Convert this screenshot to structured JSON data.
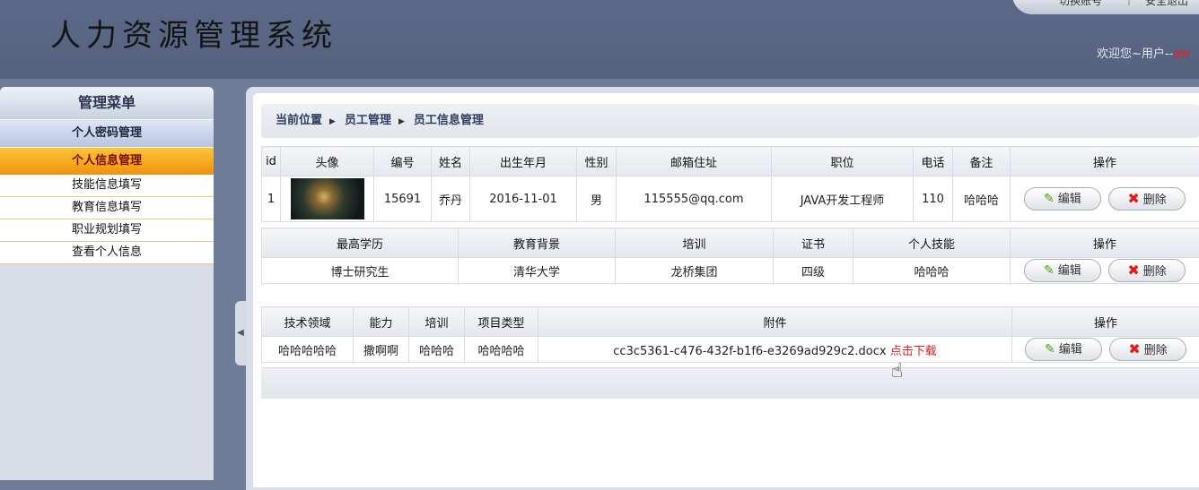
{
  "app": {
    "title": "人力资源管理系统"
  },
  "top_links": [
    "切换账号",
    "安全退出"
  ],
  "welcome": {
    "text": "欢迎您~用户--",
    "user": "qw"
  },
  "sidebar": {
    "title": "管理菜单",
    "groups": [
      {
        "label": "个人密码管理",
        "active": false
      },
      {
        "label": "个人信息管理",
        "active": true
      }
    ],
    "items": [
      "技能信息填写",
      "教育信息填写",
      "职业规划填写",
      "查看个人信息"
    ]
  },
  "breadcrumb": [
    "当前位置",
    "员工管理",
    "员工信息管理"
  ],
  "employee_table": {
    "headers": [
      "id",
      "头像",
      "编号",
      "姓名",
      "出生年月",
      "性别",
      "邮箱住址",
      "职位",
      "电话",
      "备注",
      "操作"
    ],
    "rows": [
      {
        "id": "1",
        "avatar": "avatar-image",
        "number": "15691",
        "name": "乔丹",
        "birth": "2016-11-01",
        "gender": "男",
        "email": "115555@qq.com",
        "position": "JAVA开发工程师",
        "phone": "110",
        "note": "哈哈哈"
      }
    ]
  },
  "education_table": {
    "headers": [
      "最高学历",
      "教育背景",
      "培训",
      "证书",
      "个人技能",
      "操作"
    ],
    "rows": [
      {
        "degree": "博士研究生",
        "background": "清华大学",
        "training": "龙桥集团",
        "certificate": "四级",
        "skills": "哈哈哈"
      }
    ]
  },
  "skill_table": {
    "headers": [
      "技术领域",
      "能力",
      "培训",
      "项目类型",
      "附件",
      "操作"
    ],
    "rows": [
      {
        "field": "哈哈哈哈哈",
        "ability": "撒啊啊",
        "training": "哈哈哈",
        "project_type": "哈哈哈哈",
        "attachment": "cc3c5361-c476-432f-b1f6-e3269ad929c2.docx",
        "download": "点击下载"
      }
    ]
  },
  "actions": {
    "edit": "编辑",
    "delete": "删除"
  },
  "colors": {
    "header_bg": "#5b6888",
    "active_menu": "#f0920e",
    "accent_red": "#e21c1c"
  }
}
